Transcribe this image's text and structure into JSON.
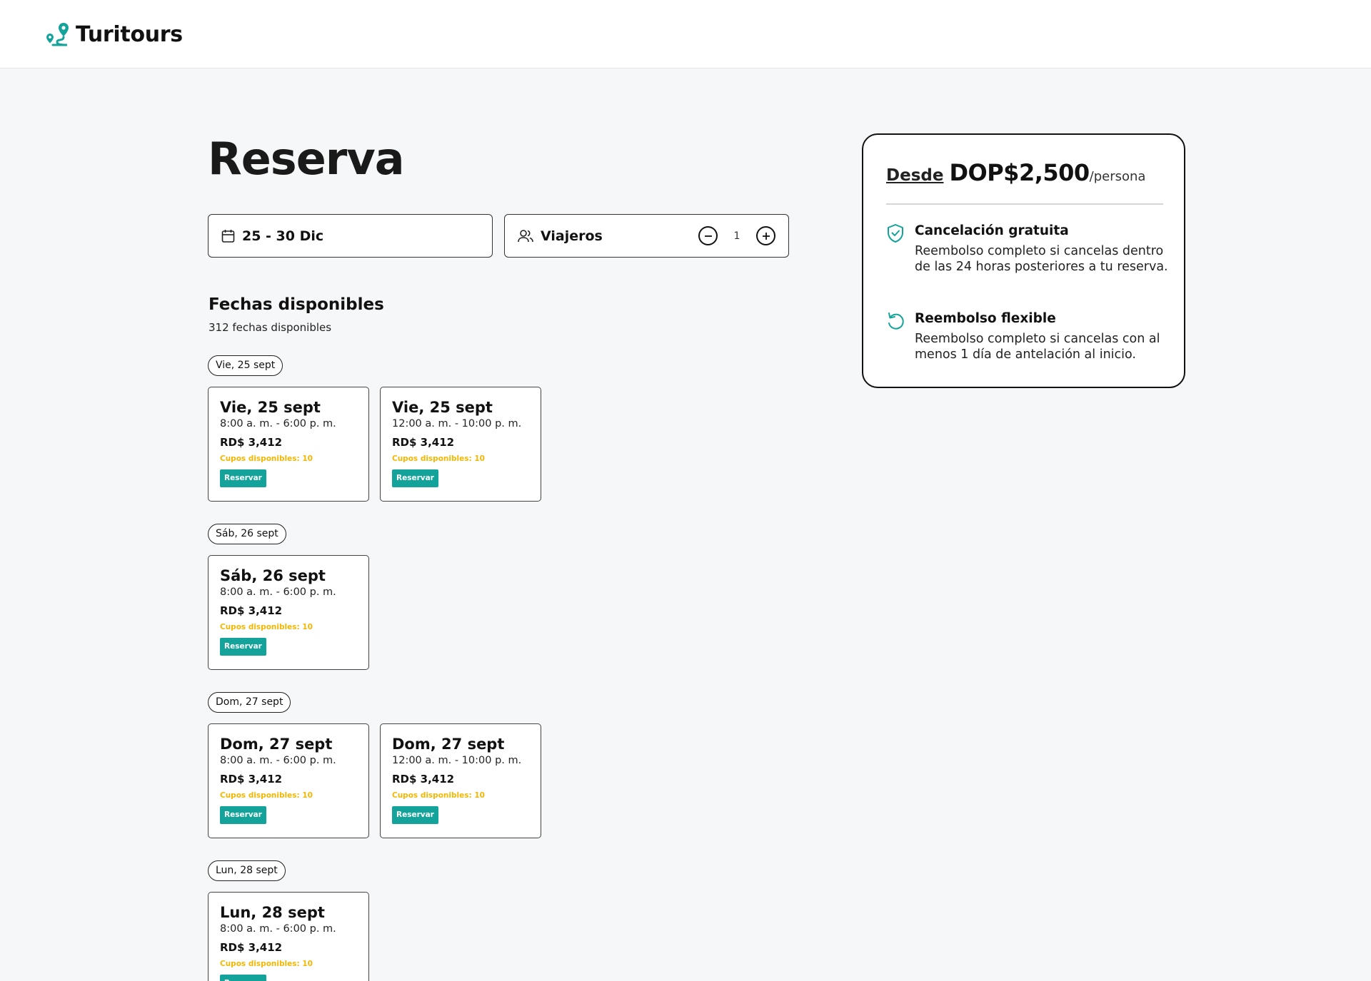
{
  "header": {
    "brand": "Turitours",
    "accent_color": "#14a39a"
  },
  "page": {
    "title": "Reserva"
  },
  "search": {
    "date_range": "25 - 30 Dic",
    "travelers_label": "Viajeros",
    "travelers_count": "1"
  },
  "availability": {
    "title": "Fechas disponibles",
    "subtitle": "312 fechas disponibles",
    "groups": [
      {
        "chip": "Vie, 25 sept",
        "slots": [
          {
            "date": "Vie, 25 sept",
            "time": "8:00 a. m. - 6:00 p. m.",
            "price": "RD$ 3,412",
            "cupos": "Cupos disponibles: 10",
            "button": "Reservar"
          },
          {
            "date": "Vie, 25 sept",
            "time": "12:00 a. m. - 10:00 p. m.",
            "price": "RD$ 3,412",
            "cupos": "Cupos disponibles: 10",
            "button": "Reservar"
          }
        ]
      },
      {
        "chip": "Sáb, 26 sept",
        "slots": [
          {
            "date": "Sáb, 26 sept",
            "time": "8:00 a. m. - 6:00 p. m.",
            "price": "RD$ 3,412",
            "cupos": "Cupos disponibles: 10",
            "button": "Reservar"
          }
        ]
      },
      {
        "chip": "Dom, 27 sept",
        "slots": [
          {
            "date": "Dom, 27 sept",
            "time": "8:00 a. m. - 6:00 p. m.",
            "price": "RD$ 3,412",
            "cupos": "Cupos disponibles: 10",
            "button": "Reservar"
          },
          {
            "date": "Dom, 27 sept",
            "time": "12:00 a. m. - 10:00 p. m.",
            "price": "RD$ 3,412",
            "cupos": "Cupos disponibles: 10",
            "button": "Reservar"
          }
        ]
      },
      {
        "chip": "Lun, 28 sept",
        "slots": [
          {
            "date": "Lun, 28 sept",
            "time": "8:00 a. m. - 6:00 p. m.",
            "price": "RD$ 3,412",
            "cupos": "Cupos disponibles: 10",
            "button": "Reservar"
          }
        ]
      }
    ]
  },
  "pricing": {
    "desde": "Desde",
    "amount": "DOP$2,500",
    "per": "/persona",
    "features": [
      {
        "icon": "shield-check-icon",
        "title": "Cancelación gratuita",
        "desc": "Reembolso completo si cancelas dentro de las 24 horas posteriores a tu reserva."
      },
      {
        "icon": "refresh-icon",
        "title": "Reembolso flexible",
        "desc": "Reembolso completo si cancelas con al menos 1 día de antelación al inicio."
      }
    ]
  },
  "colors": {
    "teal": "#14a39a",
    "cupos_yellow": "#f2b705"
  }
}
